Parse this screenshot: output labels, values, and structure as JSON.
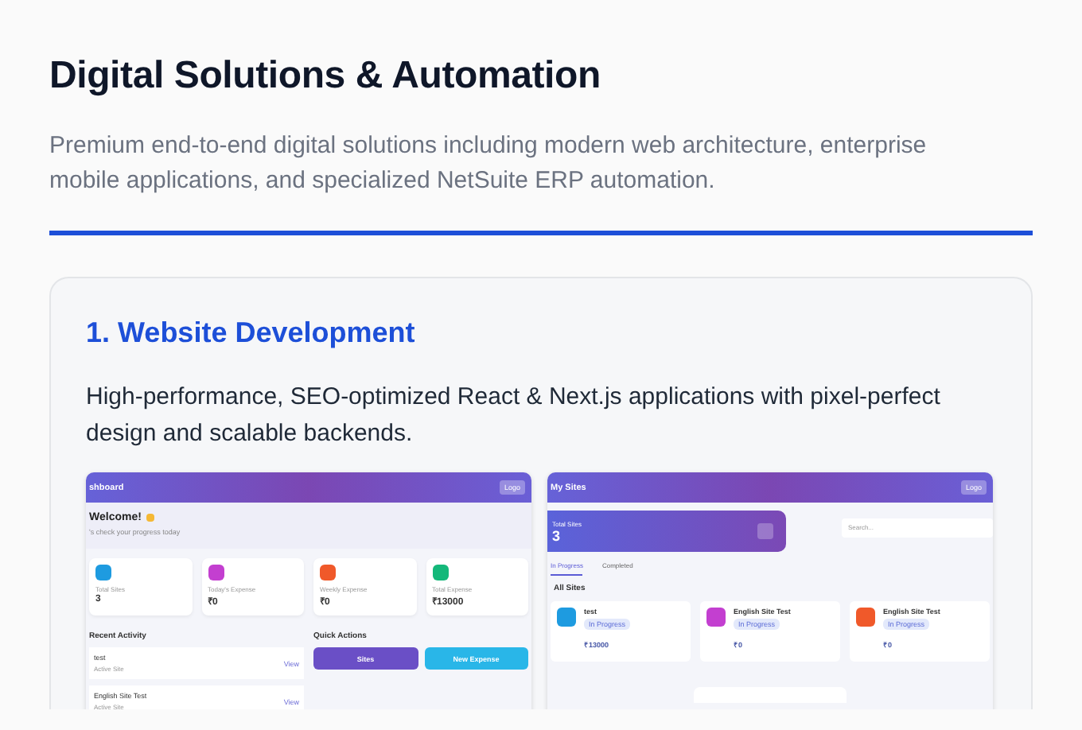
{
  "header": {
    "title": "Digital Solutions & Automation",
    "description": "Premium end-to-end digital solutions including modern web architecture, enterprise mobile applications, and specialized NetSuite ERP automation."
  },
  "section": {
    "title": "1. Website Development",
    "description": "High-performance, SEO-optimized React & Next.js applications with pixel-perfect design and scalable backends.",
    "screenshots": [
      {
        "kind": "dashboard",
        "title": "shboard",
        "button": "Logo",
        "welcome": "Welcome!",
        "subtitle": "'s check your progress today",
        "stats": [
          {
            "label": "Total Sites",
            "value": "3",
            "color": "#1e9be0"
          },
          {
            "label": "Today's Expense",
            "value": "₹0",
            "color": "#c33fd0"
          },
          {
            "label": "Weekly Expense",
            "value": "₹0",
            "color": "#f0592a"
          },
          {
            "label": "Total Expense",
            "value": "₹13000",
            "color": "#14b87a"
          }
        ],
        "recent_title": "Recent Activity",
        "activity": [
          {
            "name": "test",
            "status": "Active Site",
            "action": "View"
          },
          {
            "name": "English Site Test",
            "status": "Active Site",
            "action": "View"
          }
        ],
        "actions_title": "Quick Actions",
        "actions": [
          {
            "label": "Sites",
            "color": "#6a4fc6"
          },
          {
            "label": "New Expense",
            "color": "#29b6e8"
          }
        ]
      },
      {
        "kind": "sites",
        "title": "My Sites",
        "button": "Logo",
        "total_label": "Total Sites",
        "total_value": "3",
        "search_placeholder": "Search...",
        "tabs": [
          {
            "label": "In Progress",
            "selected": true
          },
          {
            "label": "Completed",
            "selected": false
          }
        ],
        "list_title": "All Sites",
        "sites": [
          {
            "name": "test",
            "status": "In Progress",
            "amount": "₹13000",
            "color": "#1e9be0"
          },
          {
            "name": "English Site Test",
            "status": "In Progress",
            "amount": "₹0",
            "color": "#c33fd0"
          },
          {
            "name": "English Site Test",
            "status": "In Progress",
            "amount": "₹0",
            "color": "#f0592a"
          }
        ]
      }
    ]
  }
}
